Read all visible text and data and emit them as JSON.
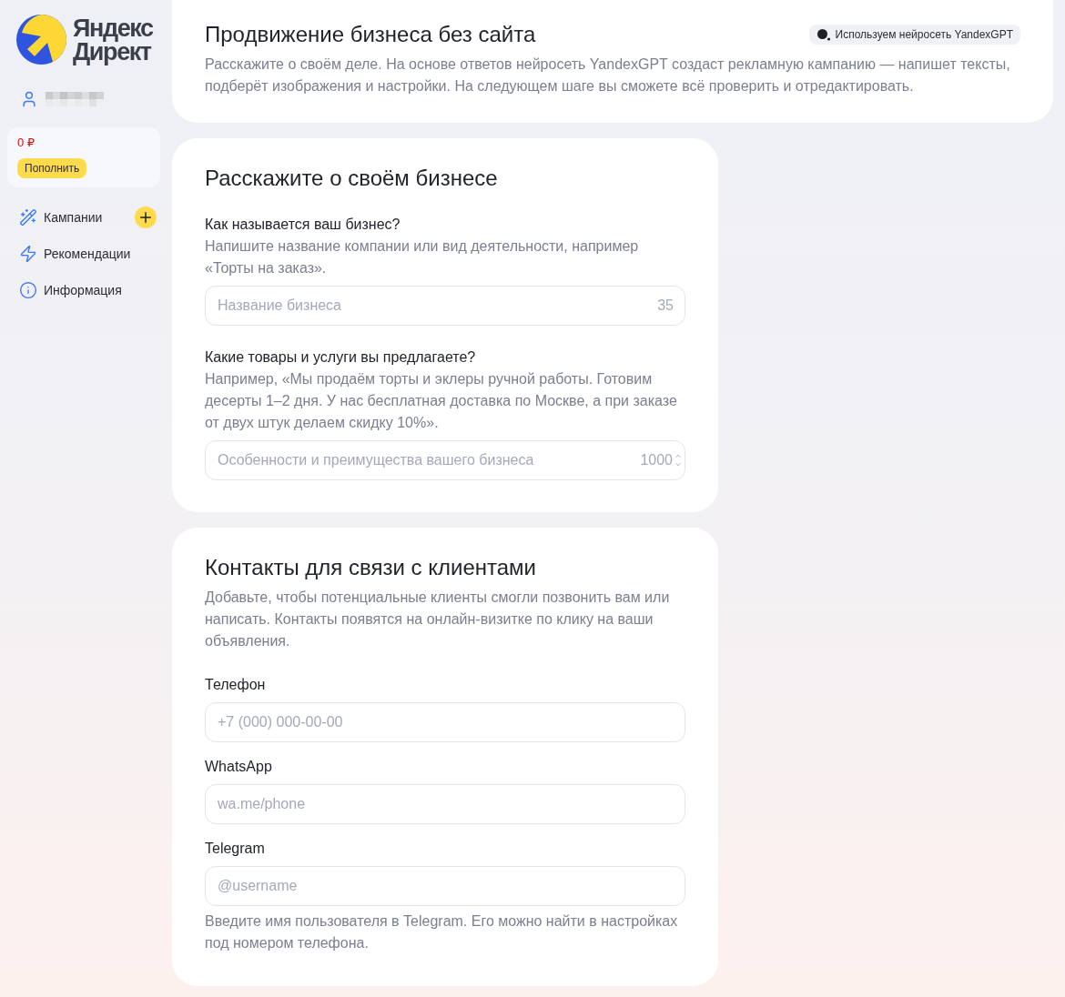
{
  "sidebar": {
    "logo": {
      "line_1": "Яндекс",
      "line_2": "Директ"
    },
    "balance": {
      "amount": "0 ₽",
      "button": "Пополнить"
    },
    "nav": [
      {
        "label": "Кампании",
        "add_button": true
      },
      {
        "label": "Рекомендации",
        "add_button": false
      },
      {
        "label": "Информация",
        "add_button": false
      }
    ]
  },
  "intro": {
    "title": "Продвижение бизнеса без сайта",
    "badge": "Используем нейросеть YandexGPT",
    "description": "Расскажите о своём деле. На основе ответов нейросеть YandexGPT создаст рекламную кампанию — напишет тексты, подберёт изображения и настройки. На следующем шаге вы сможете всё проверить и отредактировать."
  },
  "business": {
    "title": "Расскажите о своём бизнесе",
    "fields": [
      {
        "kind": "input",
        "label": "Как называется ваш бизнес?",
        "hint": "Напишите название компании или вид деятельности, например «Торты на заказ».",
        "placeholder": "Название бизнеса",
        "counter": "35"
      },
      {
        "kind": "textarea",
        "label": "Какие товары и услуги вы предлагаете?",
        "hint": "Например, «Мы продаём торты и эклеры ручной работы. Готовим десерты 1–2 дня. У нас бесплатная доставка по Москве, а при заказе от двух штук делаем скидку 10%».",
        "placeholder": "Особенности и преимущества вашего бизнеса",
        "counter": "1000"
      }
    ]
  },
  "contacts": {
    "title": "Контакты для связи с клиентами",
    "description": "Добавьте, чтобы потенциальные клиенты смогли позвонить вам или написать. Контакты появятся на онлайн-визитке по клику на ваши объявления.",
    "fields": [
      {
        "label": "Телефон",
        "placeholder": "+7 (000) 000-00-00"
      },
      {
        "label": "WhatsApp",
        "placeholder": "wa.me/phone"
      },
      {
        "label": "Telegram",
        "placeholder": "@username"
      }
    ],
    "note": "Введите имя пользователя в Telegram. Его можно найти в настройках под номером телефона."
  }
}
